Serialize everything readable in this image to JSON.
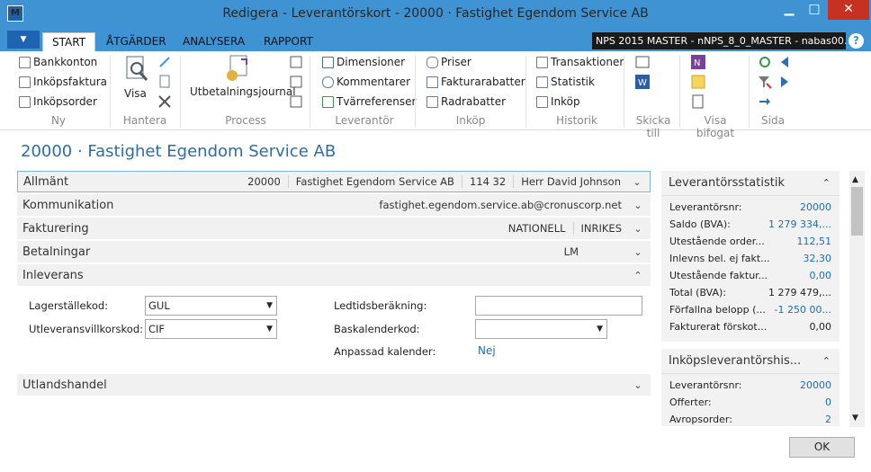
{
  "window": {
    "title": "Redigera - Leverantörskort - 20000 · Fastighet Egendom Service AB",
    "app_icon": "dynamics-nav-icon",
    "minimize": "▁",
    "maximize": "□",
    "close": "✕"
  },
  "tabs": {
    "file": "▼",
    "start": "START",
    "atgarder": "ÅTGÄRDER",
    "analysera": "ANALYSERA",
    "rapport": "RAPPORT"
  },
  "company": "NPS 2015 MASTER - nNPS_8_0_MASTER - nabas00...",
  "help": "?",
  "ribbon": {
    "ny": {
      "label": "Ny",
      "items": [
        "Bankkonton",
        "Inköpsfaktura",
        "Inköpsorder"
      ]
    },
    "hantera": {
      "label": "Hantera",
      "visa": "Visa"
    },
    "process": {
      "label": "Process",
      "item": "Utbetalningsjournal"
    },
    "leverantor": {
      "label": "Leverantör",
      "items": [
        "Dimensioner",
        "Kommentarer",
        "Tvärreferenser"
      ]
    },
    "inkop": {
      "label": "Inköp",
      "items": [
        "Priser",
        "Fakturarabatter",
        "Radrabatter"
      ]
    },
    "historik": {
      "label": "Historik",
      "items": [
        "Transaktioner",
        "Statistik",
        "Inköp"
      ]
    },
    "skicka": {
      "label": "Skicka till"
    },
    "bifogat": {
      "label": "Visa bifogat"
    },
    "sida": {
      "label": "Sida"
    }
  },
  "page_title": "20000 · Fastighet Egendom Service AB",
  "fasttabs": {
    "allmant": {
      "name": "Allmänt",
      "vals": [
        "20000",
        "Fastighet Egendom Service AB",
        "114 32",
        "Herr David Johnson"
      ]
    },
    "kommunikation": {
      "name": "Kommunikation",
      "vals": [
        "fastighet.egendom.service.ab@cronuscorp.net"
      ]
    },
    "fakturering": {
      "name": "Fakturering",
      "vals": [
        "NATIONELL",
        "INRIKES"
      ]
    },
    "betalningar": {
      "name": "Betalningar",
      "vals": [
        "LM"
      ]
    },
    "inleverans": {
      "name": "Inleverans"
    },
    "utlandshandel": {
      "name": "Utlandshandel"
    }
  },
  "inleverans": {
    "lagerstallekod_label": "Lagerställekod:",
    "lagerstallekod": "GUL",
    "utlev_label": "Utleveransvillkorskod:",
    "utlev": "CIF",
    "ledtid_label": "Ledtidsberäkning:",
    "ledtid": "",
    "baskal_label": "Baskalenderkod:",
    "baskal": "",
    "anpassad_label": "Anpassad kalender:",
    "anpassad": "Nej"
  },
  "factbox1": {
    "title": "Leverantörsstatistik",
    "rows": [
      {
        "k": "Leverantörsnr:",
        "v": "20000",
        "link": true
      },
      {
        "k": "Saldo (BVA):",
        "v": "1 279 334,...",
        "link": true
      },
      {
        "k": "Utestående order...",
        "v": "112,51",
        "link": true
      },
      {
        "k": "Inlevns bel. ej fakt...",
        "v": "32,30",
        "link": true
      },
      {
        "k": "Utestående faktur...",
        "v": "0,00",
        "link": true
      },
      {
        "k": "Total (BVA):",
        "v": "1 279 479,...",
        "link": false
      },
      {
        "k": "Förfallna belopp (...",
        "v": "-1 250 00...",
        "link": true
      },
      {
        "k": "Fakturerat förskot...",
        "v": "0,00",
        "link": false
      }
    ]
  },
  "factbox2": {
    "title": "Inköpsleverantörshis...",
    "rows": [
      {
        "k": "Leverantörsnr:",
        "v": "20000"
      },
      {
        "k": "Offerter:",
        "v": "0"
      },
      {
        "k": "Avropsorder:",
        "v": "2"
      }
    ]
  },
  "ok": "OK"
}
